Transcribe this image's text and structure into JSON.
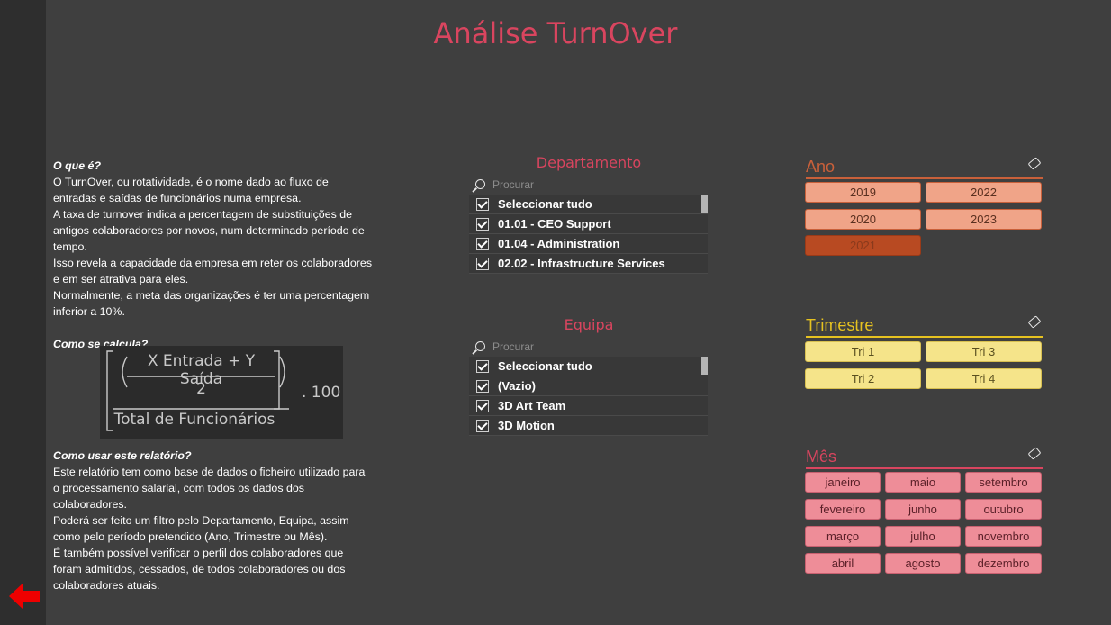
{
  "page": {
    "title": "Análise TurnOver"
  },
  "nav": {
    "back_icon": "left-arrow-icon"
  },
  "info": {
    "what_heading": "O que é?",
    "what_lines": [
      "O TurnOver, ou rotatividade, é o nome dado ao fluxo de",
      "entradas e saídas de funcionários numa empresa.",
      "A taxa de turnover indica a percentagem de substituições de",
      "antigos colaboradores por novos, num determinado período de",
      "tempo.",
      "Isso revela a capacidade da empresa em reter os colaboradores",
      "e em ser atrativa para eles.",
      "Normalmente, a meta das organizações é ter uma percentagem",
      "inferior a 10%."
    ],
    "calc_heading": "Como se calcula?",
    "formula": {
      "numerator": "X Entrada + Y Saída",
      "divisor": "2",
      "denominator": "Total de Funcionários",
      "multiplier": ". 100"
    },
    "usage_heading": "Como usar este relatório?",
    "usage_lines": [
      "Este relatório tem como base de dados o ficheiro utilizado para",
      "o processamento salarial, com todos os dados dos",
      "colaboradores.",
      "Poderá ser feito um filtro pelo Departamento, Equipa, assim",
      "como pelo período pretendido (Ano, Trimestre ou Mês).",
      "É também possível verificar o perfil dos colaboradores que",
      "foram admitidos, cessados, de todos colaboradores ou dos",
      "colaboradores atuais."
    ]
  },
  "departamento": {
    "title": "Departamento",
    "search_placeholder": "Procurar",
    "items": [
      "Seleccionar tudo",
      "01.01 - CEO Support",
      "01.04 - Administration",
      "02.02 - Infrastructure Services"
    ]
  },
  "equipa": {
    "title": "Equipa",
    "search_placeholder": "Procurar",
    "items": [
      "Seleccionar tudo",
      "(Vazio)",
      "3D Art Team",
      "3D Motion"
    ]
  },
  "ano": {
    "title": "Ano",
    "color": "#c9603a",
    "chip_color": "#f0a488",
    "selected_color": "#b84a22",
    "options": [
      "2019",
      "2022",
      "2020",
      "2023",
      "2021"
    ],
    "selected": "2021"
  },
  "trimestre": {
    "title": "Trimestre",
    "color": "#e6c220",
    "chip_color": "#f5e48a",
    "options": [
      "Tri 1",
      "Tri 3",
      "Tri 2",
      "Tri 4"
    ]
  },
  "mes": {
    "title": "Mês",
    "color": "#d9455f",
    "chip_color": "#ee8d98",
    "options": [
      "janeiro",
      "maio",
      "setembro",
      "fevereiro",
      "junho",
      "outubro",
      "março",
      "julho",
      "novembro",
      "abril",
      "agosto",
      "dezembro"
    ]
  }
}
